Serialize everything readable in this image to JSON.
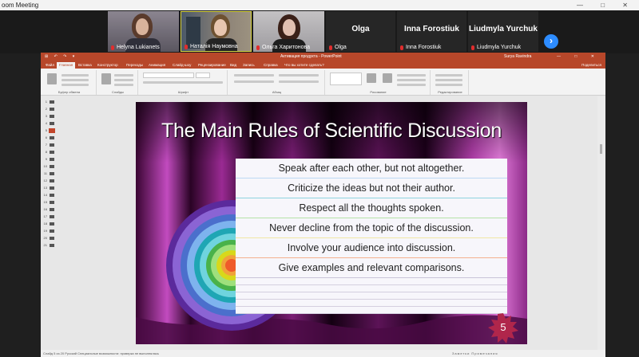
{
  "window": {
    "title": "oom Meeting",
    "controls": [
      "—",
      "□",
      "✕"
    ]
  },
  "participants": [
    {
      "name": "Helyna Lukianets",
      "has_video": true,
      "muted": true
    },
    {
      "name": "Наталія Наумовна",
      "has_video": true,
      "muted": true
    },
    {
      "name": "Ольга Харитонова",
      "has_video": true,
      "muted": true
    },
    {
      "name": "Olga",
      "display": "Olga",
      "has_video": false,
      "muted": true
    },
    {
      "name": "Inna Forostiuk",
      "display": "Inna Forostiuk",
      "has_video": false,
      "muted": true
    },
    {
      "name": "Liudmyla Yurchuk",
      "display": "Liudmyla Yurchuk",
      "has_video": false,
      "muted": true
    }
  ],
  "gallery_next_icon": "chevron-right-icon",
  "powerpoint": {
    "title": "Активация продукта - PowerPoint",
    "user": "Surya Ravindra",
    "quick_access": "⊞ ↶ ↷ ▾",
    "tabs": [
      "Файл",
      "Главная",
      "Вставка",
      "Конструктор",
      "Переходы",
      "Анимация",
      "Слайд-шоу",
      "Рецензирование",
      "Вид",
      "Запись",
      "Справка"
    ],
    "active_tab": "Главная",
    "tell_me": "Что вы хотите сделать?",
    "share": "Поделиться",
    "ribbon_groups": [
      "Буфер обмена",
      "Слайды",
      "Шрифт",
      "Абзац",
      "Рисование",
      "Редактирование"
    ],
    "status_left": "Слайд 5 из 20   Русский   Специальные возможности: проверка не выполнялась",
    "status_right": "Заметки   Примечания"
  },
  "thumbnails": [
    "1",
    "2",
    "3",
    "4",
    "5",
    "6",
    "7",
    "8",
    "9",
    "10",
    "11",
    "12",
    "13",
    "14",
    "15",
    "16",
    "17",
    "18",
    "19",
    "20",
    "21"
  ],
  "selected_thumbnail": "5",
  "slide": {
    "title": "The Main Rules of Scientific Discussion",
    "rules": [
      "Speak after each other, but not altogether.",
      "Criticize the ideas but not their author.",
      "Respect all the thoughts spoken.",
      "Never decline from the topic of the discussion.",
      "Involve your audience into discussion.",
      "Give examples and relevant comparisons."
    ],
    "slide_number": "5",
    "colors": {
      "background": "#1a0010",
      "accent": "#a3289f",
      "badge": "#b0264b"
    }
  }
}
